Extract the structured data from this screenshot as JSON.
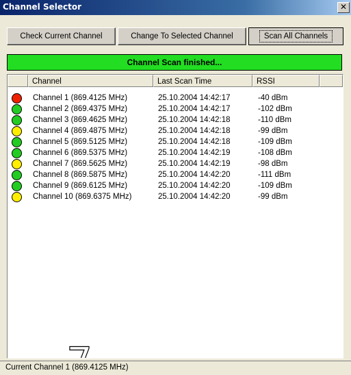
{
  "window": {
    "title": "Channel Selector",
    "close_label": "✕"
  },
  "toolbar": {
    "check_label": "Check Current Channel",
    "change_label": "Change To Selected Channel",
    "scan_label": "Scan All Channels"
  },
  "banner": {
    "text": "Channel Scan finished...",
    "color": "#22dd22"
  },
  "list": {
    "columns": [
      "",
      "Channel",
      "Last Scan Time",
      "RSSI",
      ""
    ],
    "rows": [
      {
        "status": "red",
        "channel": "Channel 1 (869.4125 MHz)",
        "time": "25.10.2004 14:42:17",
        "rssi": "-40 dBm"
      },
      {
        "status": "green",
        "channel": "Channel 2 (869.4375 MHz)",
        "time": "25.10.2004 14:42:17",
        "rssi": "-102 dBm"
      },
      {
        "status": "green",
        "channel": "Channel 3 (869.4625 MHz)",
        "time": "25.10.2004 14:42:18",
        "rssi": "-110 dBm"
      },
      {
        "status": "yellow",
        "channel": "Channel 4 (869.4875 MHz)",
        "time": "25.10.2004 14:42:18",
        "rssi": "-99 dBm"
      },
      {
        "status": "green",
        "channel": "Channel 5 (869.5125 MHz)",
        "time": "25.10.2004 14:42:18",
        "rssi": "-109 dBm"
      },
      {
        "status": "green",
        "channel": "Channel 6 (869.5375 MHz)",
        "time": "25.10.2004 14:42:19",
        "rssi": "-108 dBm"
      },
      {
        "status": "yellow",
        "channel": "Channel 7 (869.5625 MHz)",
        "time": "25.10.2004 14:42:19",
        "rssi": "-98 dBm"
      },
      {
        "status": "green",
        "channel": "Channel 8 (869.5875 MHz)",
        "time": "25.10.2004 14:42:20",
        "rssi": "-111 dBm"
      },
      {
        "status": "green",
        "channel": "Channel 9 (869.6125 MHz)",
        "time": "25.10.2004 14:42:20",
        "rssi": "-109 dBm"
      },
      {
        "status": "yellow",
        "channel": "Channel 10 (869.6375 MHz)",
        "time": "25.10.2004 14:42:20",
        "rssi": "-99 dBm"
      }
    ]
  },
  "status_colors": {
    "red": "#ee2200",
    "green": "#22cc22",
    "yellow": "#ffee00"
  },
  "overlay_number": "7",
  "statusbar": {
    "text": "Current Channel 1 (869.4125 MHz)"
  }
}
